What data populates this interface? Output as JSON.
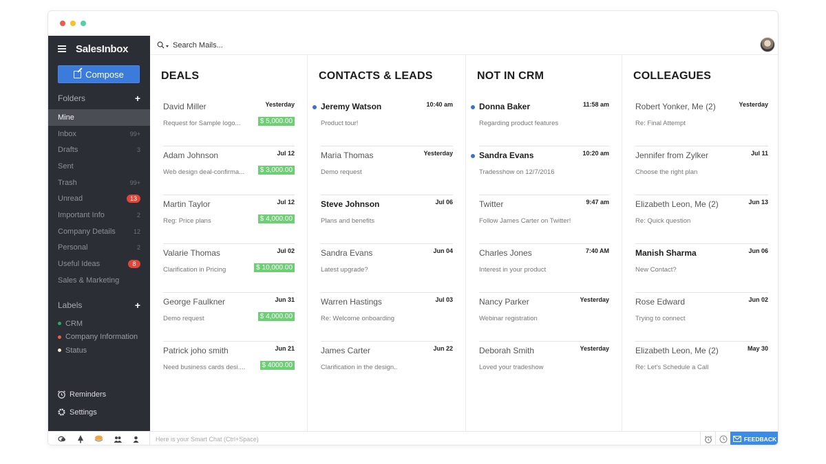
{
  "app": {
    "name": "SalesInbox"
  },
  "sidebar": {
    "compose_label": "Compose",
    "folders_title": "Folders",
    "folders": [
      {
        "label": "Mine",
        "count": "",
        "badge": "",
        "active": true
      },
      {
        "label": "Inbox",
        "count": "99+",
        "badge": ""
      },
      {
        "label": "Drafts",
        "count": "3",
        "badge": ""
      },
      {
        "label": "Sent",
        "count": "",
        "badge": ""
      },
      {
        "label": "Trash",
        "count": "99+",
        "badge": ""
      },
      {
        "label": "Unread",
        "count": "",
        "badge": "13"
      },
      {
        "label": "Important Info",
        "count": "2",
        "badge": ""
      },
      {
        "label": "Company Details",
        "count": "12",
        "badge": ""
      },
      {
        "label": "Personal",
        "count": "2",
        "badge": ""
      },
      {
        "label": "Useful Ideas",
        "count": "",
        "badge": "8"
      },
      {
        "label": "Sales & Marketing",
        "count": "",
        "badge": ""
      }
    ],
    "labels_title": "Labels",
    "labels": [
      {
        "label": "CRM",
        "color": "#2ea66a"
      },
      {
        "label": "Company Information",
        "color": "#e8624a"
      },
      {
        "label": "Status",
        "color": "#f6f1c8"
      }
    ],
    "reminders_label": "Reminders",
    "settings_label": "Settings"
  },
  "search": {
    "placeholder": "Search Mails..."
  },
  "columns": [
    {
      "title": "DEALS",
      "items": [
        {
          "name": "David Miller",
          "time": "Yesterday",
          "subject": "Request for Sample logo...",
          "amount": "$ 5,000.00"
        },
        {
          "name": "Adam Johnson",
          "time": "Jul 12",
          "subject": "Web design deal-confirma...",
          "amount": "$ 3,000.00"
        },
        {
          "name": "Martin Taylor",
          "time": "Jul 12",
          "subject": "Reg: Price plans",
          "amount": "$ 4,000.00"
        },
        {
          "name": "Valarie Thomas",
          "time": "Jul 02",
          "subject": "Clarification in Pricing",
          "amount": "$ 10,000.00"
        },
        {
          "name": "George Faulkner",
          "time": "Jun 31",
          "subject": "Demo request",
          "amount": "$ 4,000.00"
        },
        {
          "name": "Patrick joho smith",
          "time": "Jun 21",
          "subject": "Need business cards desi....",
          "amount": "$ 4000.00"
        }
      ]
    },
    {
      "title": "CONTACTS & LEADS",
      "items": [
        {
          "name": "Jeremy Watson",
          "time": "10:40 am",
          "subject": "Product tour!",
          "unread": true
        },
        {
          "name": "Maria Thomas",
          "time": "Yesterday",
          "subject": "Demo request"
        },
        {
          "name": "Steve Johnson",
          "time": "Jul 06",
          "subject": "Plans and benefits",
          "bold": true
        },
        {
          "name": "Sandra Evans",
          "time": "Jun 04",
          "subject": "Latest upgrade?"
        },
        {
          "name": "Warren Hastings",
          "time": "Jul 03",
          "subject": "Re: Welcome onboarding"
        },
        {
          "name": "James Carter",
          "time": "Jun 22",
          "subject": "Clarification in the design.."
        }
      ]
    },
    {
      "title": "NOT IN CRM",
      "items": [
        {
          "name": "Donna Baker",
          "time": "11:58 am",
          "subject": "Regarding product features",
          "unread": true
        },
        {
          "name": "Sandra Evans",
          "time": "10:20 am",
          "subject": "Tradesshow on 12/7/2016",
          "unread": true
        },
        {
          "name": "Twitter",
          "time": "9:47 am",
          "subject": "Follow James Carter on Twitter!"
        },
        {
          "name": "Charles Jones",
          "time": "7:40 AM",
          "subject": "Interest in your product"
        },
        {
          "name": "Nancy Parker",
          "time": "Yesterday",
          "subject": "Webinar registration"
        },
        {
          "name": "Deborah Smith",
          "time": "Yesterday",
          "subject": "Loved your tradeshow"
        }
      ]
    },
    {
      "title": "COLLEAGUES",
      "items": [
        {
          "name": "Robert Yonker, Me (2)",
          "time": "Yesterday",
          "subject": "Re: Final Attempt"
        },
        {
          "name": "Jennifer from Zylker",
          "time": "Jul 11",
          "subject": "Choose the right plan"
        },
        {
          "name": "Elizabeth Leon, Me (2)",
          "time": "Jun 13",
          "subject": "Re: Quick question"
        },
        {
          "name": "Manish Sharma",
          "time": "Jun 06",
          "subject": "New Contact?",
          "bold": true
        },
        {
          "name": "Rose Edward",
          "time": "Jun 02",
          "subject": "Trying to connect"
        },
        {
          "name": "Elizabeth Leon, Me (2)",
          "time": "May 30",
          "subject": "Re: Let's Schedule a Call"
        }
      ]
    }
  ],
  "bottombar": {
    "smart_chat_placeholder": "Here is your Smart Chat (Ctrl+Space)",
    "feedback_label": "FEEDBACK"
  }
}
